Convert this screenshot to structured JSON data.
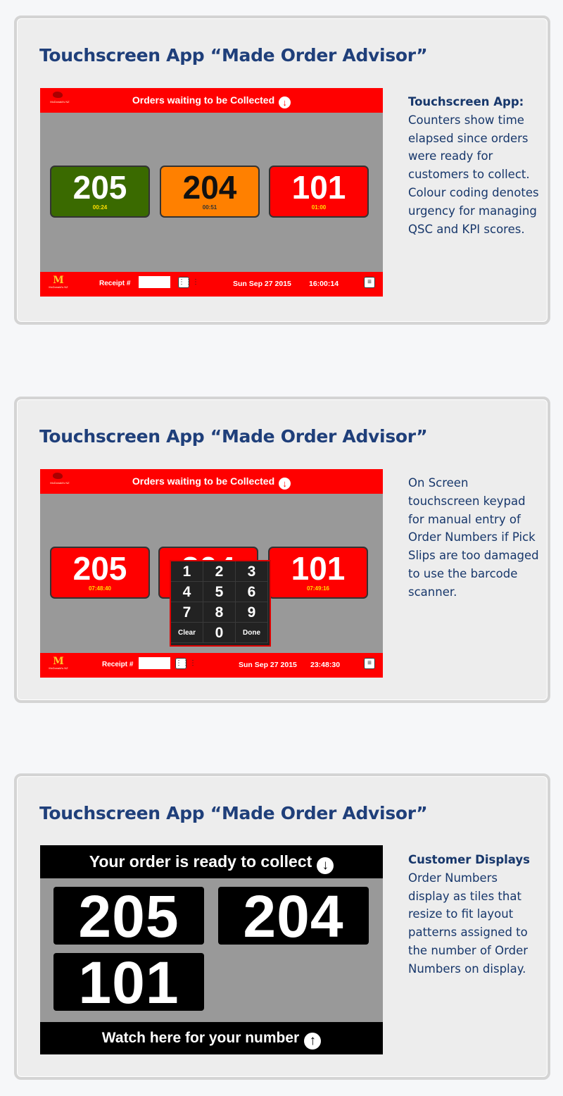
{
  "cards": [
    {
      "title": "Touchscreen App “Made Order Advisor”",
      "desc_bold": "Touchscreen App:",
      "desc": "Counters show time elapsed since orders were ready for customers to collect. Colour coding denotes urgency for managing QSC and KPI scores.",
      "screen": {
        "header": "Orders waiting to be Collected",
        "logo_text": "McDonald's NZ",
        "tiles": [
          {
            "number": "205",
            "time": "00:24",
            "color": "#3a6a00"
          },
          {
            "number": "204",
            "time": "00:51",
            "color": "#ff8000"
          },
          {
            "number": "101",
            "time": "01:00",
            "color": "#ff0000"
          }
        ],
        "receipt_label": "Receipt #",
        "date": "Sun Sep 27 2015",
        "time": "16:00:14"
      }
    },
    {
      "title": "Touchscreen App “Made Order Advisor”",
      "desc": "On Screen touchscreen keypad for manual entry of Order Numbers if Pick Slips are too damaged to use the barcode scanner.",
      "screen": {
        "header": "Orders waiting to be Collected",
        "logo_text": "McDonald's NZ",
        "tiles": [
          {
            "number": "205",
            "time": "07:48:40",
            "color": "#ff0000"
          },
          {
            "number": "204",
            "time": "",
            "color": "#ff0000"
          },
          {
            "number": "101",
            "time": "07:49:16",
            "color": "#ff0000"
          }
        ],
        "keypad": [
          "1",
          "2",
          "3",
          "4",
          "5",
          "6",
          "7",
          "8",
          "9",
          "Clear",
          "0",
          "Done"
        ],
        "receipt_label": "Receipt #",
        "date": "Sun Sep 27 2015",
        "time": "23:48:30"
      }
    },
    {
      "title": "Touchscreen App “Made Order Advisor”",
      "desc_bold": "Customer Displays",
      "desc": "Order Numbers display as tiles that resize to fit layout patterns assigned to the number of Order Numbers on display.",
      "display": {
        "header": "Your order is ready to collect",
        "numbers": [
          "205",
          "204",
          "101"
        ],
        "footer": "Watch here for your number"
      }
    }
  ],
  "icons": {
    "arrow_down": "arrow-down-circle-icon",
    "arrow_up": "arrow-up-circle-icon",
    "keypad": "keypad-icon",
    "menu": "menu-icon"
  }
}
